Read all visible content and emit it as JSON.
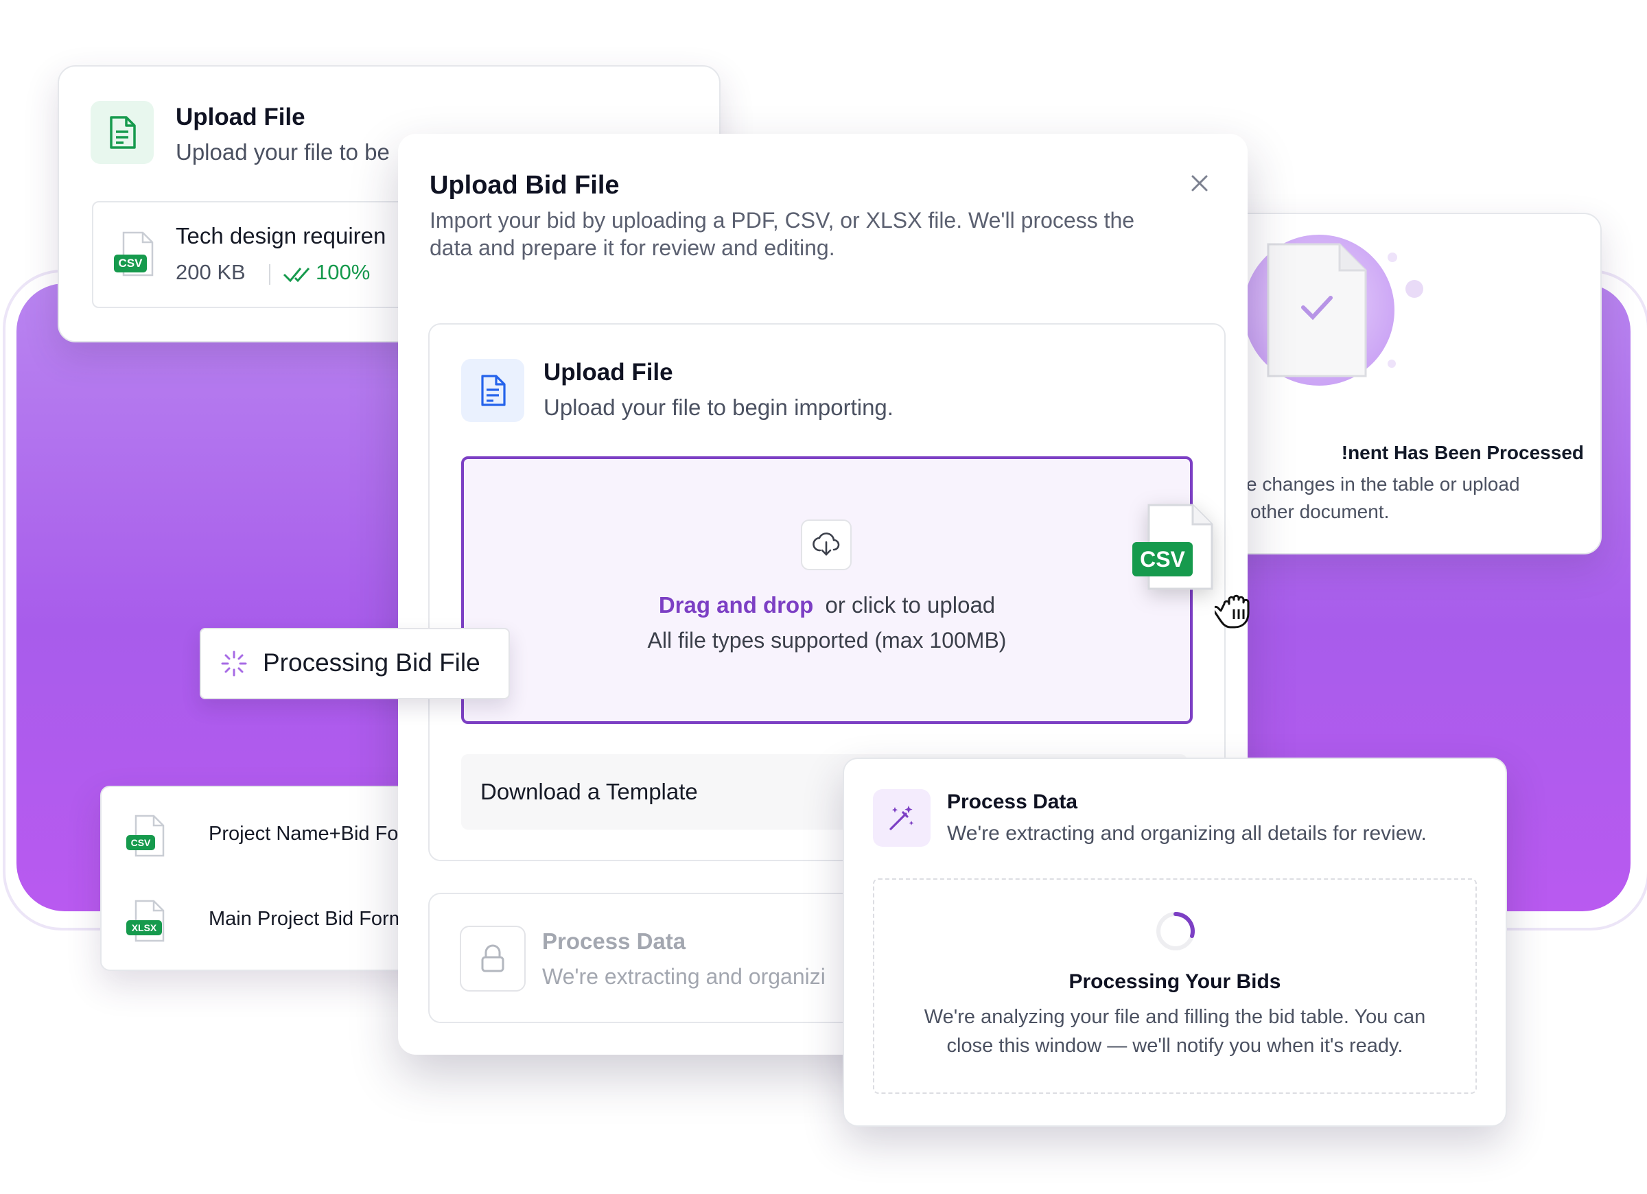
{
  "bg_card_upload": {
    "title": "Upload File",
    "subtitle": "Upload your file to be",
    "file_name": "Tech design requiren",
    "file_size": "200 KB",
    "file_progress": "100%",
    "file_tag": "CSV"
  },
  "modal": {
    "title": "Upload Bid File",
    "description_line1": "Import your bid by uploading a PDF, CSV, or XLSX file. We'll process the",
    "description_line2": "data and prepare it for review and editing.",
    "step_upload": {
      "title": "Upload File",
      "subtitle": "Upload your file to begin importing."
    },
    "dropzone": {
      "drag_label": "Drag and drop",
      "click_label": "or click to upload",
      "hint": "All file types supported (max 100MB)"
    },
    "template_label": "Download a Template",
    "step_process": {
      "title": "Process Data",
      "subtitle": "We're extracting and organizi"
    }
  },
  "drag_file_tag": "CSV",
  "processed_card": {
    "title": "nent Has Been Processed!",
    "line1": "e changes in the table or upload",
    "line2": "other document."
  },
  "processing_chip": {
    "label": "Processing Bid File"
  },
  "file_list": [
    {
      "name": "Project Name+Bid Forn",
      "tag": "CSV"
    },
    {
      "name": "Main Project Bid Form.:",
      "tag": "XLSX"
    }
  ],
  "process_card": {
    "title": "Process Data",
    "subtitle": "We're extracting and organizing all details for review.",
    "status_title": "Processing Your Bids",
    "status_line1": "We're analyzing your file and filling the bid table. You can",
    "status_line2": "close this window — we'll notify you when it's ready."
  },
  "colors": {
    "accent": "#7c3fc4",
    "green": "#169a4d",
    "dropzone_bg": "#f8f3fd",
    "purple_bg": "#a85ceb"
  }
}
